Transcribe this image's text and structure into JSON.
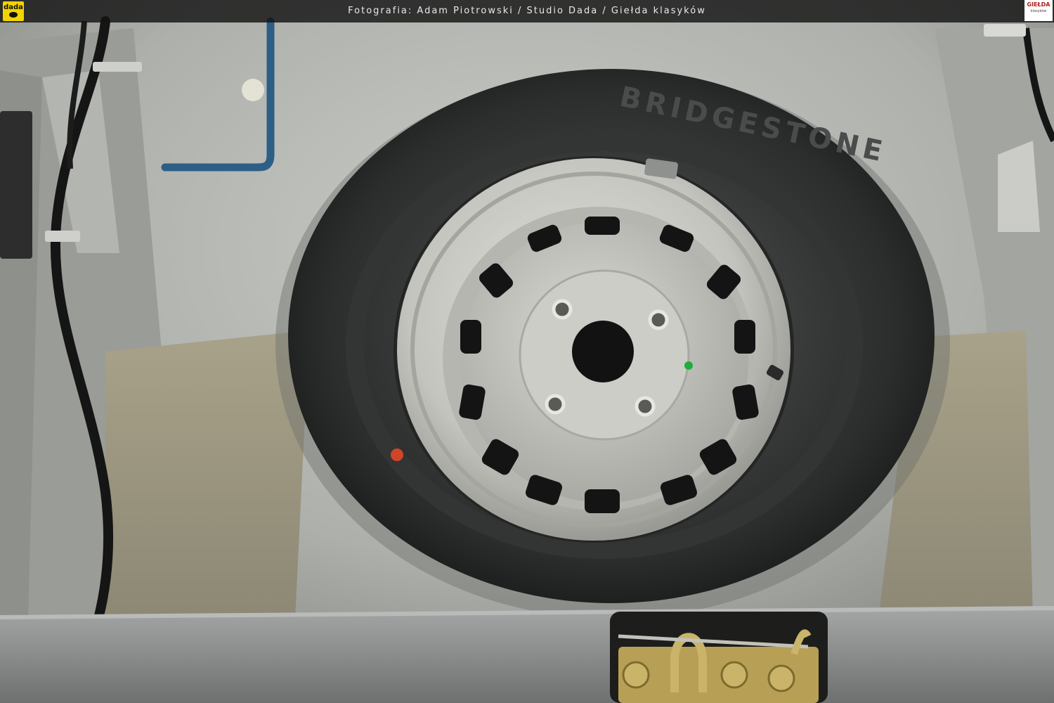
{
  "photo": {
    "description_visible": false
  },
  "header": {
    "credit": "Fotografia: Adam Piotrowski / Studio Dada / Giełda klasyków",
    "logo_left": "dada",
    "logo_right": "GIEŁDA",
    "logo_right_sub": "klasyków"
  },
  "tire": {
    "brand_text": "BRIDGESTONE"
  },
  "colors": {
    "topbar": "#151515",
    "logo_yellow": "#f2d400",
    "body_silver": "#b8bab6",
    "tire_black": "#2a2b2b",
    "rim_silver": "#cfcfca",
    "floor": "#9c9782",
    "sill": "#8d8f8f",
    "latch_gold": "#b7a055",
    "pipe_blue": "#2d5e86"
  }
}
